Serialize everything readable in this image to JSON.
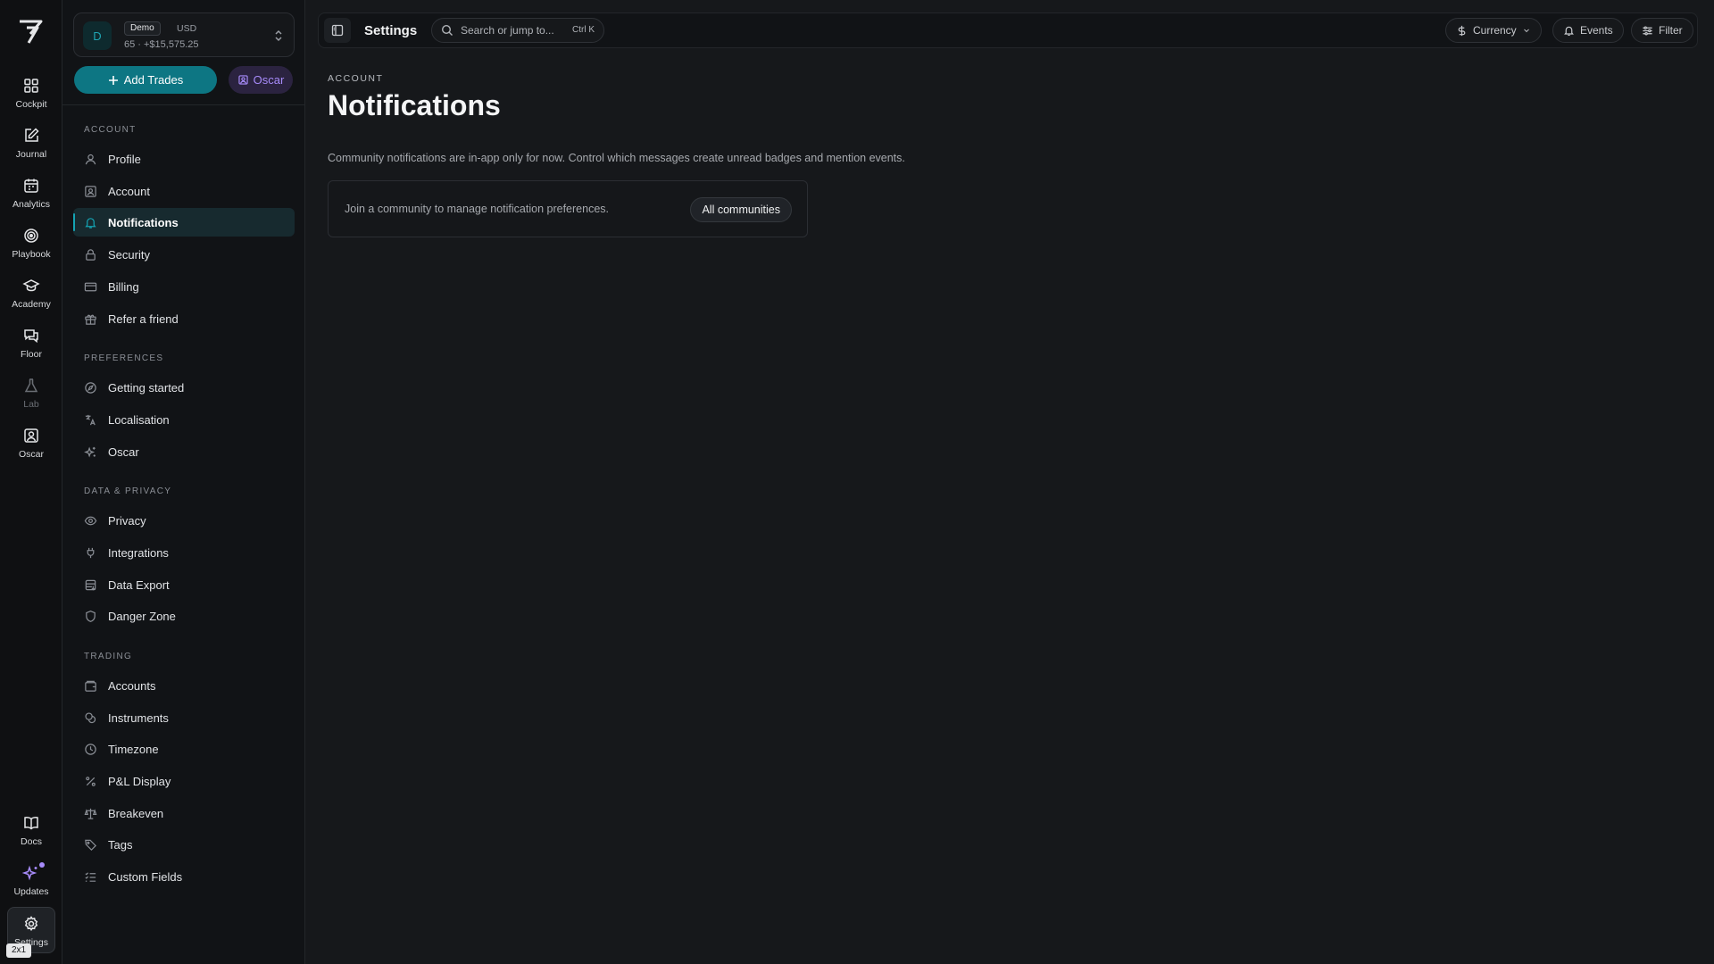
{
  "rail": {
    "items": [
      {
        "label": "Cockpit",
        "icon": "grid-icon"
      },
      {
        "label": "Journal",
        "icon": "edit-icon"
      },
      {
        "label": "Analytics",
        "icon": "calendar-icon"
      },
      {
        "label": "Playbook",
        "icon": "target-icon"
      },
      {
        "label": "Academy",
        "icon": "graduation-cap-icon"
      },
      {
        "label": "Floor",
        "icon": "chat-icon"
      },
      {
        "label": "Lab",
        "icon": "flask-icon"
      },
      {
        "label": "Oscar",
        "icon": "bot-icon"
      }
    ],
    "bottom": [
      {
        "label": "Docs",
        "icon": "book-icon"
      },
      {
        "label": "Updates",
        "icon": "sparkles-icon"
      },
      {
        "label": "Settings",
        "icon": "gear-icon"
      }
    ],
    "zoom_badge": "2x1"
  },
  "account_switcher": {
    "avatar_letter": "D",
    "badge": "Demo",
    "currency": "USD",
    "summary": "65 · +$15,575.25"
  },
  "actions": {
    "add_trades": "Add Trades",
    "oscar": "Oscar"
  },
  "sidebar": {
    "sections": [
      {
        "label": "ACCOUNT",
        "items": [
          "Profile",
          "Account",
          "Notifications",
          "Security",
          "Billing",
          "Refer a friend"
        ]
      },
      {
        "label": "PREFERENCES",
        "items": [
          "Getting started",
          "Localisation",
          "Oscar"
        ]
      },
      {
        "label": "DATA & PRIVACY",
        "items": [
          "Privacy",
          "Integrations",
          "Data Export",
          "Danger Zone"
        ]
      },
      {
        "label": "TRADING",
        "items": [
          "Accounts",
          "Instruments",
          "Timezone",
          "P&L Display",
          "Breakeven",
          "Tags",
          "Custom Fields"
        ]
      }
    ],
    "active_item": "Notifications"
  },
  "topbar": {
    "title": "Settings",
    "search_placeholder": "Search or jump to...",
    "search_shortcut": "Ctrl K",
    "currency": "Currency",
    "events": "Events",
    "filter": "Filter"
  },
  "main": {
    "kicker": "ACCOUNT",
    "title": "Notifications",
    "description": "Community notifications are in-app only for now. Control which messages create unread badges and mention events.",
    "card": {
      "text": "Join a community to manage notification preferences.",
      "button": "All communities"
    }
  },
  "colors": {
    "accent": "#0d7683",
    "accent_bright": "#14a3b3",
    "oscar_purple": "#a78bfa",
    "background": "#16181b"
  }
}
